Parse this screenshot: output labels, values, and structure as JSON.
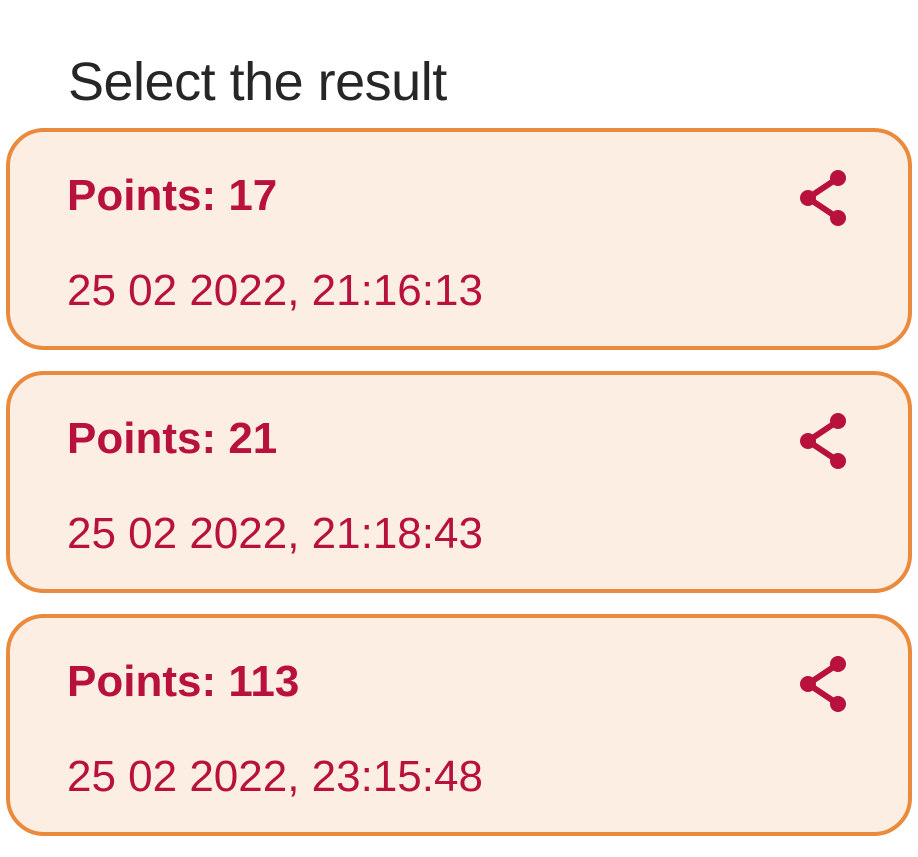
{
  "title": "Select the result",
  "colors": {
    "accent": "#b8113e",
    "card_border": "#e98a3c",
    "card_background": "#fdeee3"
  },
  "results": [
    {
      "points": "Points: 17",
      "date": "25 02 2022, 21:16:13",
      "icon": "share-icon"
    },
    {
      "points": "Points: 21",
      "date": "25 02 2022, 21:18:43",
      "icon": "share-icon"
    },
    {
      "points": "Points: 113",
      "date": "25 02 2022, 23:15:48",
      "icon": "share-icon"
    }
  ]
}
